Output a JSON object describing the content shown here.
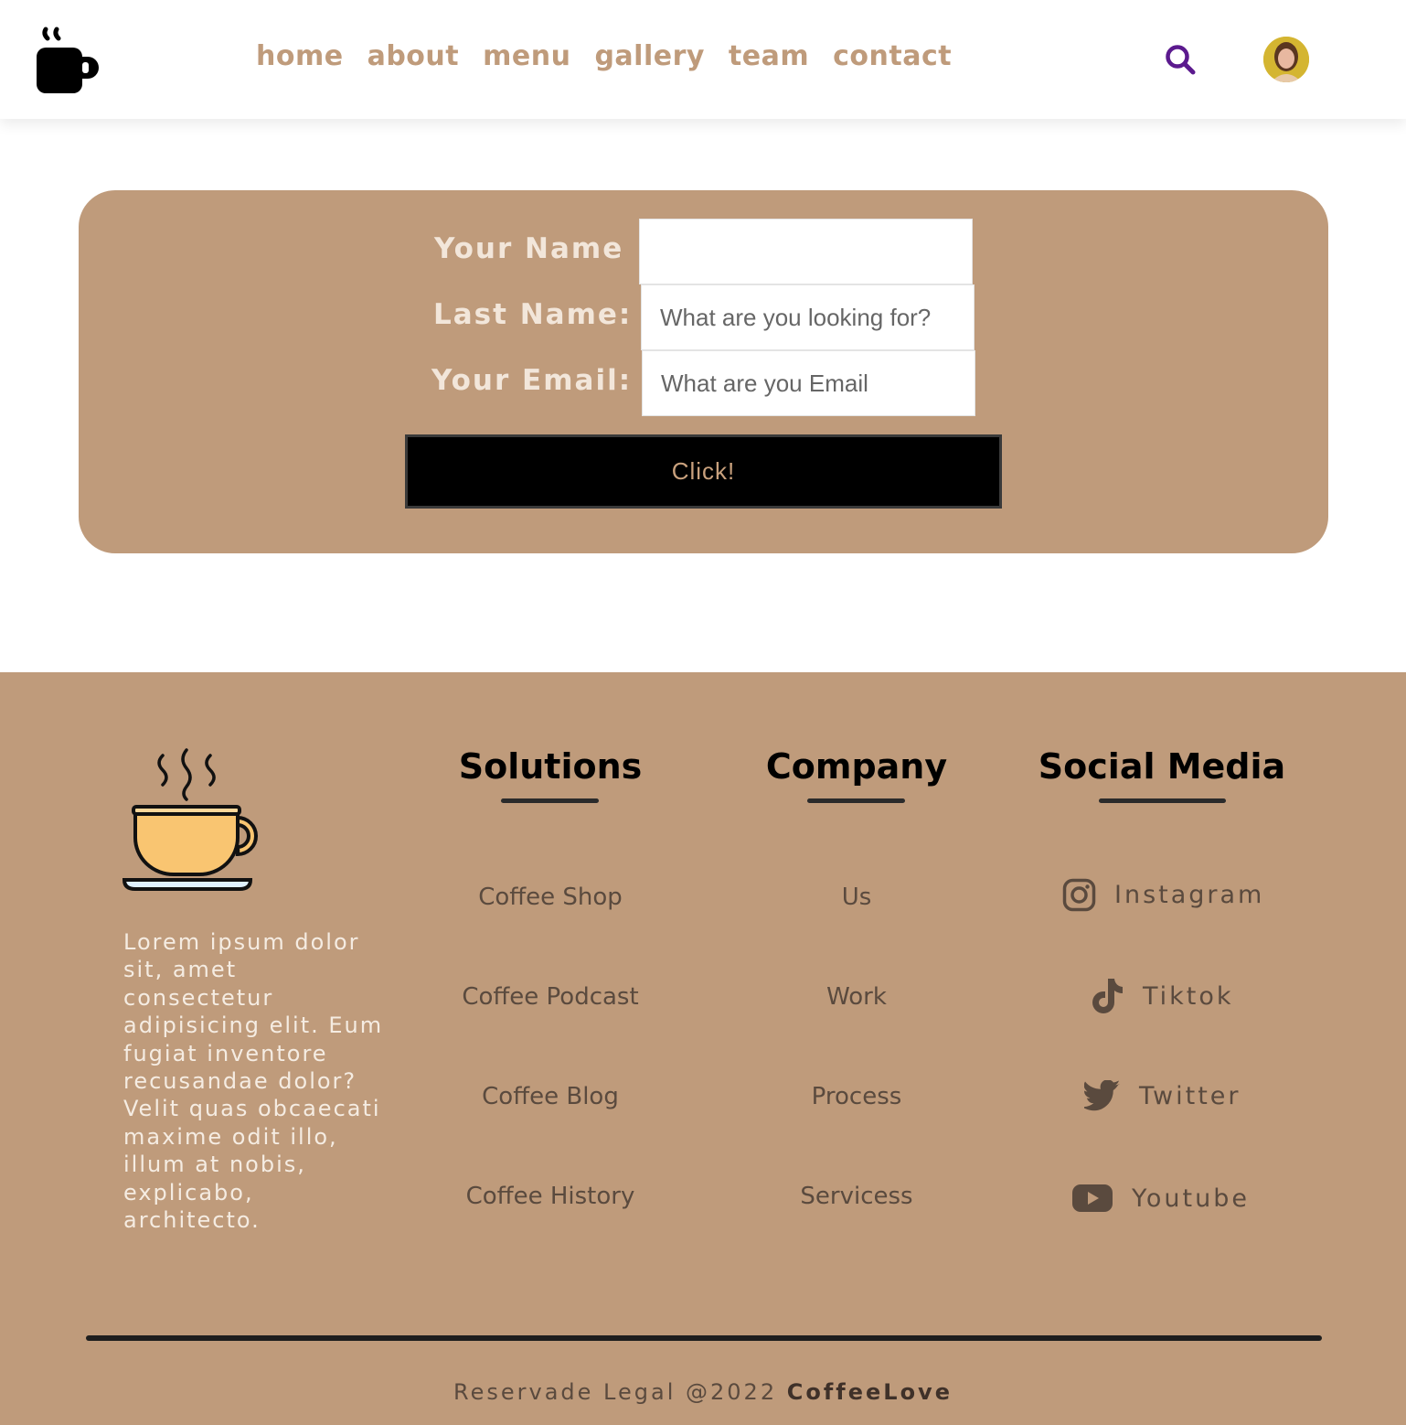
{
  "header": {
    "nav": [
      "home",
      "about",
      "menu",
      "gallery",
      "team",
      "contact"
    ],
    "icons": {
      "logo": "coffee-mug-icon",
      "search": "search-icon",
      "avatar": "user-avatar"
    },
    "colors": {
      "nav": "#bf9b7b",
      "search": "#5b1a8e"
    }
  },
  "form": {
    "name_label": "Your Name",
    "last_name_label": "Last Name:",
    "last_name_placeholder": "What are you looking for?",
    "email_label": "Your Email:",
    "email_placeholder": "What are you Email",
    "submit_label": "Click!",
    "colors": {
      "card": "#bf9b7b",
      "button": "#000000",
      "button_text": "#c9a17d"
    }
  },
  "footer": {
    "about": "Lorem ipsum dolor sit, amet consectetur adipisicing elit. Eum fugiat inventore recusandae dolor? Velit quas obcaecati maxime odit illo, illum at nobis, explicabo, architecto.",
    "solutions": {
      "title": "Solutions",
      "links": [
        "Coffee Shop",
        "Coffee Podcast",
        "Coffee Blog",
        "Coffee History"
      ]
    },
    "company": {
      "title": "Company",
      "links": [
        "Us",
        "Work",
        "Process",
        "Servicess"
      ]
    },
    "social": {
      "title": "Social Media",
      "links": [
        "Instagram",
        "Tiktok",
        "Twitter",
        "Youtube"
      ]
    },
    "copyright_prefix": "Reservade Legal @2022",
    "brand": "CoffeeLove",
    "colors": {
      "background": "#bf9b7b"
    }
  }
}
